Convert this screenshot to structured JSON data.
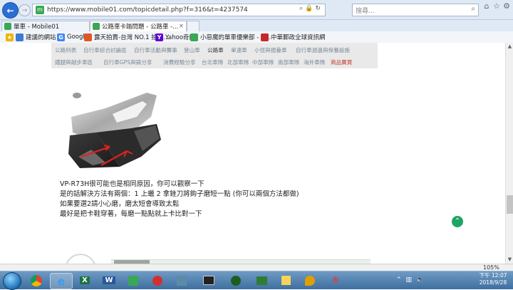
{
  "browser": {
    "url": "https://www.mobile01.com/topicdetail.php?f=316&t=4237574",
    "search_placeholder": "搜尋...",
    "tabs": [
      {
        "title": "單車 - Mobile01",
        "active": false
      },
      {
        "title": "公路車卡踏問題 - 公路車 -...",
        "active": true
      }
    ],
    "favorites": [
      {
        "label": "建議的網站 ▾",
        "icon": "suggested-sites-icon"
      },
      {
        "label": "Google",
        "icon": "google-icon"
      },
      {
        "label": "露天拍賣-台灣 NO.1 拍賣...",
        "icon": "ruten-icon"
      },
      {
        "label": "Yahoo奇摩",
        "icon": "yahoo-icon"
      },
      {
        "label": "小惡魔的單車優樂部 - 單...",
        "icon": "mobile01-icon"
      },
      {
        "label": "中華郵政全球資訊網",
        "icon": "chunghwa-post-icon"
      }
    ],
    "zoom_level": "105%"
  },
  "page": {
    "categories_row1": [
      "公路列表",
      "自行車綜合討論區",
      "自行車活動與賽事",
      "登山車",
      "公路車",
      "單速車",
      "小徑與摺疊車",
      "自行車週邊與保養設施"
    ],
    "categories_row2": [
      "鐵腿與越步車區",
      "自行車GPS與錶分享",
      "消費經驗分享",
      "台北車隊",
      "北部車隊",
      "中部車隊",
      "南部車隊",
      "海外車隊",
      "商品賣買"
    ],
    "post_lines": [
      "VP-R73H很可能也是相同原因，你可以觀察一下",
      "是的話解決方法有兩個：1 上蠟 2 拿銼刀將鉤子磨短一點 (你可以兩個方法都做)",
      "如果要選2請小心磨，磨太短會導致太鬆",
      "最好是把卡鞋穿著，每磨一點點就上卡比對一下"
    ]
  },
  "taskbar": {
    "clock_time": "下午 12:07",
    "clock_date": "2018/9/28"
  },
  "colors": {
    "accent_green": "#1fa463",
    "ie_blue": "#2a6fd6",
    "category_red": "#c0392b"
  }
}
